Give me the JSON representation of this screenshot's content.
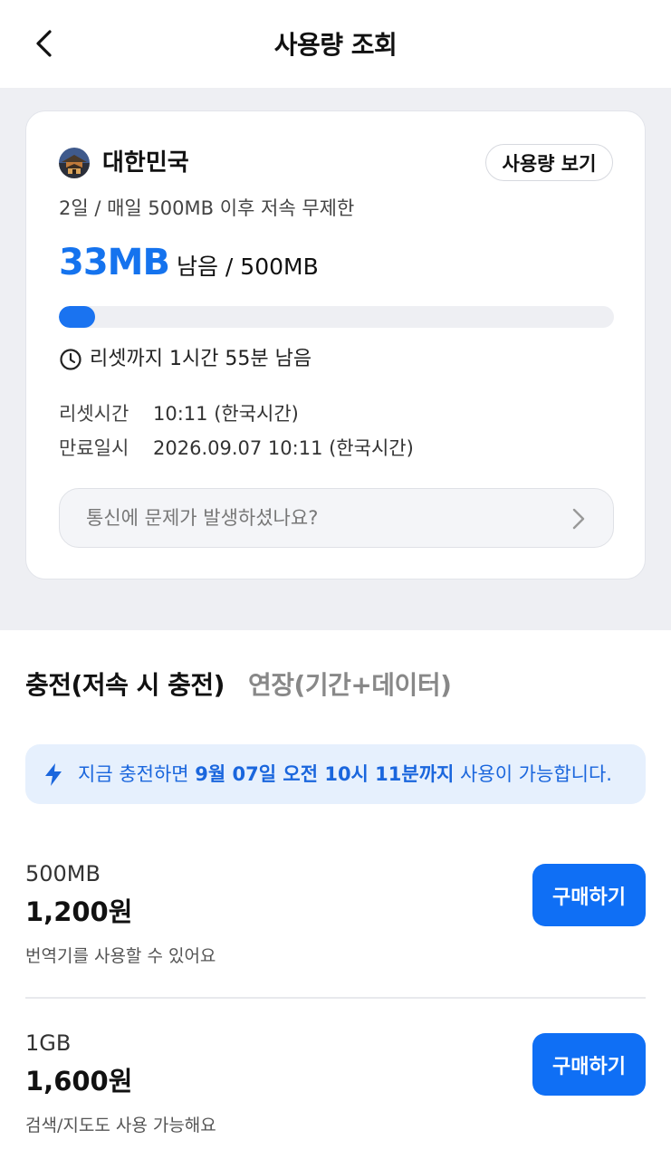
{
  "header": {
    "title": "사용량 조회"
  },
  "card": {
    "country": "대한민국",
    "view_usage_label": "사용량 보기",
    "plan": "2일 / 매일 500MB 이후 저속 무제한",
    "remaining_amount": "33MB",
    "remaining_suffix": "남음 / 500MB",
    "usage_remaining_fraction": 0.066,
    "reset_countdown": "리셋까지 1시간 55분 남음",
    "reset_time_label": "리셋시간",
    "reset_time_value": "10:11 (한국시간)",
    "expiry_label": "만료일시",
    "expiry_value": "2026.09.07 10:11 (한국시간)",
    "issue_prompt": "통신에 문제가 발생하셨나요?"
  },
  "tabs": [
    {
      "label": "충전(저속 시 충전)",
      "active": true
    },
    {
      "label": "연장(기간+데이터)",
      "active": false
    }
  ],
  "notice": {
    "prefix": "지금 충전하면 ",
    "highlight": "9월 07일 오전 10시 11분까지",
    "suffix": " 사용이 가능합니다."
  },
  "products": [
    {
      "size": "500MB",
      "price": "1,200원",
      "desc": "번역기를 사용할 수 있어요",
      "buy_label": "구매하기"
    },
    {
      "size": "1GB",
      "price": "1,600원",
      "desc": "검색/지도도 사용 가능해요",
      "buy_label": "구매하기"
    }
  ],
  "colors": {
    "accent": "#1573ee",
    "button": "#0f6ff5",
    "notice_bg": "#e6f0fd",
    "page_bg": "#eeeff3"
  },
  "icons": [
    "chevron-left-icon",
    "korea-landmark-flag-icon",
    "clock-icon",
    "chevron-right-icon",
    "lightning-icon"
  ]
}
